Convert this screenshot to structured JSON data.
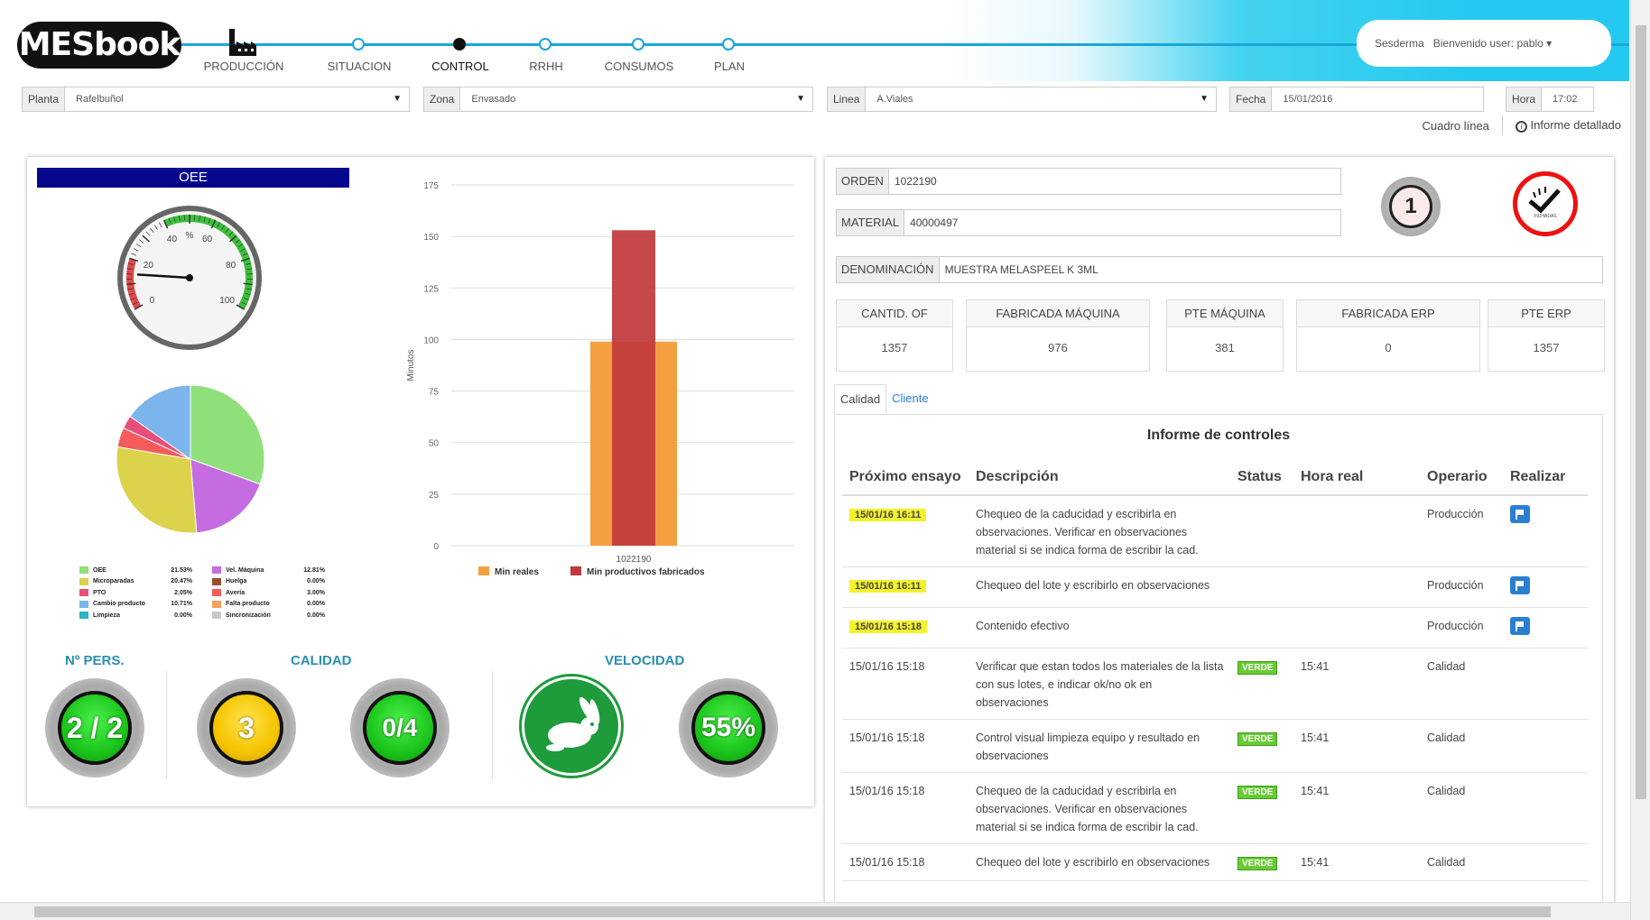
{
  "header": {
    "logo": "MESbook",
    "steps": [
      {
        "label": "PRODUCCIÓN",
        "active": false
      },
      {
        "label": "SITUACION",
        "active": false
      },
      {
        "label": "CONTROL",
        "active": true
      },
      {
        "label": "RRHH",
        "active": false
      },
      {
        "label": "CONSUMOS",
        "active": false
      },
      {
        "label": "PLAN",
        "active": false
      }
    ],
    "company": "Sesderma",
    "welcome": "Bienvenido user: pablo"
  },
  "filters": {
    "planta": {
      "label": "Planta",
      "value": "Rafelbuñol"
    },
    "zona": {
      "label": "Zona",
      "value": "Envasado"
    },
    "linea": {
      "label": "Linea",
      "value": "A.Viales"
    },
    "fecha": {
      "label": "Fecha",
      "value": "15/01/2016"
    },
    "hora": {
      "label": "Hora",
      "value": "17:02"
    }
  },
  "links": {
    "cuadro": "Cuadro línea",
    "informe": "Informe detallado"
  },
  "oee": {
    "title": "OEE",
    "gauge": {
      "value": 20,
      "ticks": [
        "20",
        "40",
        "%",
        "60",
        "80",
        "100",
        "0"
      ]
    },
    "pie": [
      {
        "name": "OEE",
        "pct": "21.53%",
        "value": 21.53,
        "color": "#8fe07a"
      },
      {
        "name": "Microparadas",
        "pct": "20.47%",
        "value": 20.47,
        "color": "#dcd24c"
      },
      {
        "name": "PTO",
        "pct": "2.05%",
        "value": 2.05,
        "color": "#e84e7a"
      },
      {
        "name": "Cambio producto",
        "pct": "10.71%",
        "value": 10.71,
        "color": "#7cb5ec"
      },
      {
        "name": "Limpieza",
        "pct": "0.00%",
        "value": 0,
        "color": "#2ab5c5"
      },
      {
        "name": "Vel. Máquina",
        "pct": "12.81%",
        "value": 12.81,
        "color": "#c56ce0"
      },
      {
        "name": "Huelga",
        "pct": "0.00%",
        "value": 0,
        "color": "#9a4f28"
      },
      {
        "name": "Avería",
        "pct": "3.00%",
        "value": 3.0,
        "color": "#f45b5b"
      },
      {
        "name": "Falta producto",
        "pct": "0.00%",
        "value": 0,
        "color": "#f4a15b"
      },
      {
        "name": "Sincronización",
        "pct": "0.00%",
        "value": 0,
        "color": "#c8c8c8"
      }
    ]
  },
  "chart_data": {
    "type": "bar",
    "categories": [
      "1022190"
    ],
    "series": [
      {
        "name": "Min reales",
        "values": [
          99
        ],
        "color": "#f4a040"
      },
      {
        "name": "Min productivos fabricados",
        "values": [
          153
        ],
        "color": "#c0393b"
      }
    ],
    "ylabel": "Minutos",
    "ylim": [
      0,
      175
    ],
    "yticks": [
      "0",
      "25",
      "50",
      "75",
      "100",
      "125",
      "150",
      "175"
    ],
    "legend": "bottom"
  },
  "kpis": {
    "pers_title": "Nº PERS.",
    "pers_value": "2 / 2",
    "calidad_title": "CALIDAD",
    "calidad_a": "3",
    "calidad_b": "0/4",
    "velocidad_title": "VELOCIDAD",
    "velocidad_value": "55%"
  },
  "order": {
    "orden_label": "ORDEN",
    "orden": "1022190",
    "material_label": "MATERIAL",
    "material": "40000497",
    "denom_label": "DENOMINACIÓN",
    "denom": "MUESTRA MELASPEEL K 3ML",
    "badge": "1",
    "badge2_caption": "FICHADAS"
  },
  "stats": [
    {
      "label": "CANTID. OF",
      "value": "1357"
    },
    {
      "label": "FABRICADA MÁQUINA",
      "value": "976"
    },
    {
      "label": "PTE MÁQUINA",
      "value": "381"
    },
    {
      "label": "FABRICADA ERP",
      "value": "0"
    },
    {
      "label": "PTE ERP",
      "value": "1357"
    }
  ],
  "tabs": {
    "calidad": "Calidad",
    "cliente": "Cliente"
  },
  "report": {
    "title": "Informe de controles",
    "cols": {
      "proximo": "Próximo ensayo",
      "desc": "Descripción",
      "status": "Status",
      "hora": "Hora real",
      "operario": "Operario",
      "realizar": "Realizar"
    },
    "rows": [
      {
        "date": "15/01/16 16:11",
        "pending": true,
        "desc": "Chequeo de la caducidad y escribirla en observaciones. Verificar en observaciones material si se indica forma de escribir la cad.",
        "status": "",
        "hora": "",
        "operario": "Producción"
      },
      {
        "date": "15/01/16 16:11",
        "pending": true,
        "desc": "Chequeo del lote y escribirlo en observaciones",
        "status": "",
        "hora": "",
        "operario": "Producción"
      },
      {
        "date": "15/01/16 15:18",
        "pending": true,
        "desc": "Contenido efectivo",
        "status": "",
        "hora": "",
        "operario": "Producción"
      },
      {
        "date": "15/01/16 15:18",
        "pending": false,
        "desc": "Verificar que estan todos los materiales de la lista con sus lotes, e indicar ok/no ok en observaciones",
        "status": "VERDE",
        "hora": "15:41",
        "operario": "Calidad"
      },
      {
        "date": "15/01/16 15:18",
        "pending": false,
        "desc": "Control visual limpieza equipo y resultado en observaciones",
        "status": "VERDE",
        "hora": "15:41",
        "operario": "Calidad"
      },
      {
        "date": "15/01/16 15:18",
        "pending": false,
        "desc": "Chequeo de la caducidad y escribirla en observaciones. Verificar en observaciones material si se indica forma de escribir la cad.",
        "status": "VERDE",
        "hora": "15:41",
        "operario": "Calidad"
      },
      {
        "date": "15/01/16 15:18",
        "pending": false,
        "desc": "Chequeo del lote y escribirlo en observaciones",
        "status": "VERDE",
        "hora": "15:41",
        "operario": "Calidad"
      }
    ]
  }
}
